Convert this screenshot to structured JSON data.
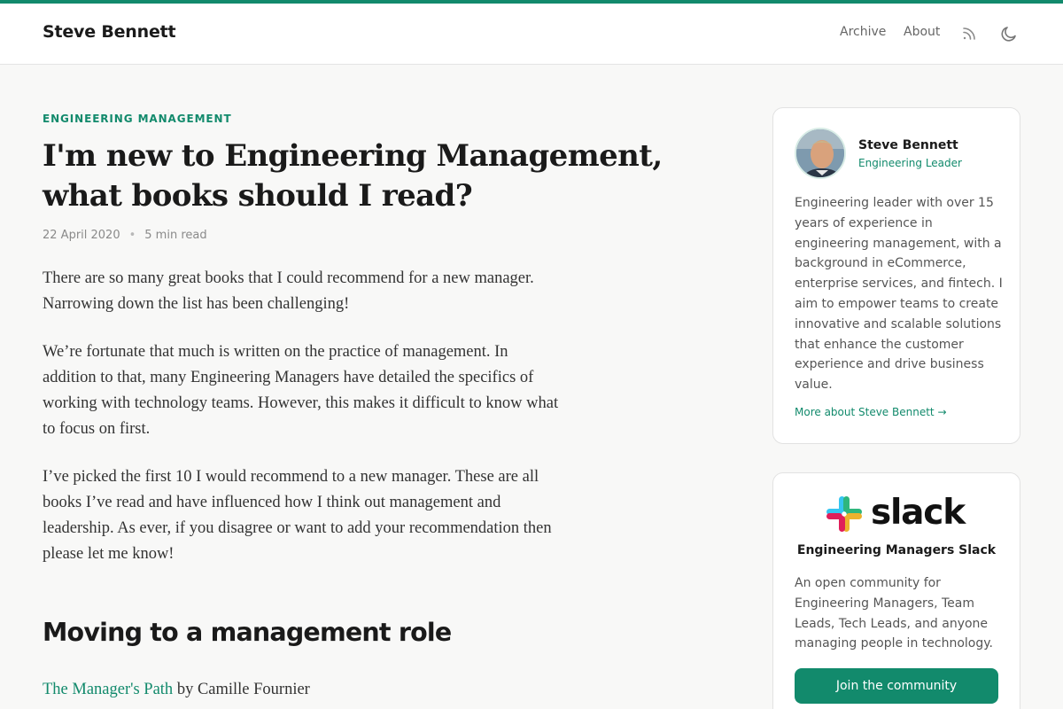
{
  "site": {
    "title": "Steve Bennett"
  },
  "nav": {
    "archive": "Archive",
    "about": "About",
    "rss_icon": "rss-icon",
    "theme_icon": "moon-icon"
  },
  "colors": {
    "accent": "#128a6c",
    "background": "#f8f8f7",
    "card": "#ffffff"
  },
  "article": {
    "category": "ENGINEERING MANAGEMENT",
    "title": "I'm new to Engineering Management, what books should I read?",
    "date": "22 April 2020",
    "separator": "•",
    "read_time": "5 min read",
    "paragraphs": [
      "There are so many great books that I could recommend for a new manager. Narrowing down the list has been challenging!",
      "We’re fortunate that much is written on the practice of management. In addition to that, many Engineering Managers have detailed the specifics of working with technology teams. However, this makes it difficult to know what to focus on first.",
      "I’ve picked the first 10 I would recommend to a new manager. These are all books I’ve read and have influenced how I think out management and leadership. As ever, if you disagree or want to add your recommendation then please let me know!"
    ],
    "section_heading": "Moving to a management role",
    "book": {
      "title": "The Manager's Path",
      "byline": " by Camille Fournier"
    }
  },
  "author_card": {
    "name": "Steve Bennett",
    "role": "Engineering Leader",
    "bio": "Engineering leader with over 15 years of experience in engineering management, with a background in eCommerce, enterprise services, and fintech. I aim to empower teams to create innovative and scalable solutions that enhance the customer experience and drive business value.",
    "more_link": "More about Steve Bennett →"
  },
  "slack_card": {
    "logo_text": "slack",
    "title": "Engineering Managers Slack",
    "description": "An open community for Engineering Managers, Team Leads, Tech Leads, and anyone managing people in technology.",
    "button": "Join the community"
  }
}
